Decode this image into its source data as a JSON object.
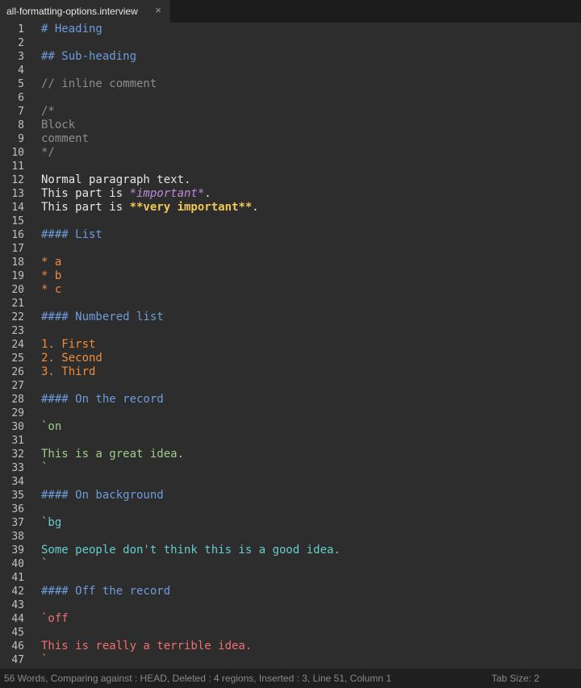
{
  "tab": {
    "title": "all-formatting-options.interview",
    "close_symbol": "×"
  },
  "status": {
    "left": "56 Words, Comparing against : HEAD, Deleted : 4 regions, Inserted : 3, Line 51, Column 1",
    "tab_size": "Tab Size: 2"
  },
  "lines": [
    {
      "n": "1",
      "segs": [
        {
          "t": "# Heading",
          "c": "heading"
        }
      ]
    },
    {
      "n": "2",
      "segs": []
    },
    {
      "n": "3",
      "segs": [
        {
          "t": "## Sub-heading",
          "c": "heading"
        }
      ]
    },
    {
      "n": "4",
      "segs": []
    },
    {
      "n": "5",
      "segs": [
        {
          "t": "// inline comment",
          "c": "comment"
        }
      ]
    },
    {
      "n": "6",
      "segs": []
    },
    {
      "n": "7",
      "segs": [
        {
          "t": "/*",
          "c": "comment"
        }
      ]
    },
    {
      "n": "8",
      "segs": [
        {
          "t": "Block",
          "c": "comment"
        }
      ]
    },
    {
      "n": "9",
      "segs": [
        {
          "t": "comment",
          "c": "comment"
        }
      ]
    },
    {
      "n": "10",
      "segs": [
        {
          "t": "*/",
          "c": "comment"
        }
      ]
    },
    {
      "n": "11",
      "segs": []
    },
    {
      "n": "12",
      "segs": [
        {
          "t": "Normal paragraph text.",
          "c": "text"
        }
      ]
    },
    {
      "n": "13",
      "segs": [
        {
          "t": "This part is ",
          "c": "text"
        },
        {
          "t": "*important*",
          "c": "emph"
        },
        {
          "t": ".",
          "c": "text"
        }
      ]
    },
    {
      "n": "14",
      "segs": [
        {
          "t": "This part is ",
          "c": "text"
        },
        {
          "t": "**very important**",
          "c": "strong"
        },
        {
          "t": ".",
          "c": "text"
        }
      ]
    },
    {
      "n": "15",
      "segs": []
    },
    {
      "n": "16",
      "segs": [
        {
          "t": "#### List",
          "c": "heading"
        }
      ]
    },
    {
      "n": "17",
      "segs": []
    },
    {
      "n": "18",
      "segs": [
        {
          "t": "* a",
          "c": "list"
        }
      ]
    },
    {
      "n": "19",
      "segs": [
        {
          "t": "* b",
          "c": "list"
        }
      ]
    },
    {
      "n": "20",
      "segs": [
        {
          "t": "* c",
          "c": "list"
        }
      ]
    },
    {
      "n": "21",
      "segs": []
    },
    {
      "n": "22",
      "segs": [
        {
          "t": "#### Numbered list",
          "c": "heading"
        }
      ]
    },
    {
      "n": "23",
      "segs": []
    },
    {
      "n": "24",
      "segs": [
        {
          "t": "1. First",
          "c": "list"
        }
      ]
    },
    {
      "n": "25",
      "segs": [
        {
          "t": "2. Second",
          "c": "list"
        }
      ]
    },
    {
      "n": "26",
      "segs": [
        {
          "t": "3. Third",
          "c": "list"
        }
      ]
    },
    {
      "n": "27",
      "segs": []
    },
    {
      "n": "28",
      "segs": [
        {
          "t": "#### On the record",
          "c": "heading"
        }
      ]
    },
    {
      "n": "29",
      "segs": []
    },
    {
      "n": "30",
      "segs": [
        {
          "t": "`on",
          "c": "on"
        }
      ]
    },
    {
      "n": "31",
      "segs": []
    },
    {
      "n": "32",
      "segs": [
        {
          "t": "This is a great idea.",
          "c": "on"
        }
      ]
    },
    {
      "n": "33",
      "segs": [
        {
          "t": "`",
          "c": "on"
        }
      ]
    },
    {
      "n": "34",
      "segs": []
    },
    {
      "n": "35",
      "segs": [
        {
          "t": "#### On background",
          "c": "heading"
        }
      ]
    },
    {
      "n": "36",
      "segs": []
    },
    {
      "n": "37",
      "segs": [
        {
          "t": "`bg",
          "c": "bg"
        }
      ]
    },
    {
      "n": "38",
      "segs": []
    },
    {
      "n": "39",
      "segs": [
        {
          "t": "Some people don't think this is a good idea.",
          "c": "bg"
        }
      ]
    },
    {
      "n": "40",
      "segs": [
        {
          "t": "`",
          "c": "bg"
        }
      ]
    },
    {
      "n": "41",
      "segs": []
    },
    {
      "n": "42",
      "segs": [
        {
          "t": "#### Off the record",
          "c": "heading"
        }
      ]
    },
    {
      "n": "43",
      "segs": []
    },
    {
      "n": "44",
      "segs": [
        {
          "t": "`off",
          "c": "off"
        }
      ]
    },
    {
      "n": "45",
      "segs": []
    },
    {
      "n": "46",
      "segs": [
        {
          "t": "This is really a terrible idea.",
          "c": "off"
        }
      ]
    },
    {
      "n": "47",
      "segs": [
        {
          "t": "`",
          "c": "off"
        }
      ]
    }
  ]
}
